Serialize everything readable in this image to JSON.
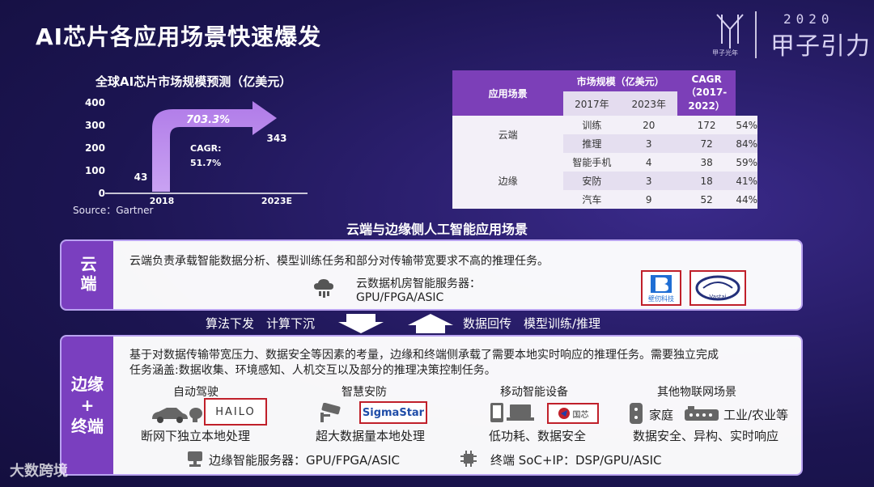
{
  "slide": {
    "title": "AI芯片各应用场景快速爆发",
    "logo_caption": "甲子光年",
    "logo_year": "2020",
    "logo_name": "甲子引力",
    "watermark": "大数跨境"
  },
  "chart_data": {
    "type": "bar",
    "title": "全球AI芯片市场规模预测（亿美元）",
    "categories": [
      "2018",
      "2023E"
    ],
    "values": [
      43,
      343
    ],
    "ylim": [
      0,
      400
    ],
    "yticks": [
      "400",
      "300",
      "200",
      "100",
      "0"
    ],
    "value_labels": [
      "43",
      "343"
    ],
    "growth_label": "703.3%",
    "cagr_label": "CAGR:",
    "cagr_value": "51.7%",
    "source": "Source：Gartner"
  },
  "table": {
    "header_scene": "应用场景",
    "header_market": "市场规模（亿美元）",
    "header_cagr": "CAGR（2017-2022）",
    "header_2017": "2017年",
    "header_2023": "2023年",
    "groups": [
      {
        "name": "云端",
        "rows": [
          {
            "item": "训练",
            "v2017": "20",
            "v2023": "172",
            "cagr": "54%"
          },
          {
            "item": "推理",
            "v2017": "3",
            "v2023": "72",
            "cagr": "84%"
          }
        ]
      },
      {
        "name": "边缘",
        "rows": [
          {
            "item": "智能手机",
            "v2017": "4",
            "v2023": "38",
            "cagr": "59%"
          },
          {
            "item": "安防",
            "v2017": "3",
            "v2023": "18",
            "cagr": "41%"
          },
          {
            "item": "汽车",
            "v2017": "9",
            "v2023": "52",
            "cagr": "44%"
          }
        ]
      }
    ]
  },
  "section_title": "云端与边缘侧人工智能应用场景",
  "cloud": {
    "side_label": "云端",
    "desc": "云端负责承载智能数据分析、模型训练任务和部分对传输带宽要求不高的推理任务。",
    "server_line1": "云数据机房智能服务器：",
    "server_line2": "GPU/FPGA/ASIC",
    "logo1": "壁仞科技",
    "logo2": "Vastai"
  },
  "flow": {
    "down_label": "算法下发　计算下沉",
    "up_label": "数据回传　模型训练/推理"
  },
  "edge": {
    "side_label_1": "边缘",
    "side_label_2": "+",
    "side_label_3": "终端",
    "desc_line1": "基于对数据传输带宽压力、数据安全等因素的考量，边缘和终端侧承载了需要本地实时响应的推理任务。需要独立完成",
    "desc_line2": "任务涵盖:数据收集、环境感知、人机交互以及部分的推理决策控制任务。",
    "scenarios": [
      {
        "title": "自动驾驶",
        "caption": "断网下独立本地处理",
        "logo": "HAILO"
      },
      {
        "title": "智慧安防",
        "caption": "超大数据量本地处理",
        "logo": "SigmaStar"
      },
      {
        "title": "移动智能设备",
        "caption": "低功耗、数据安全",
        "logo": "国芯"
      },
      {
        "title": "其他物联网场景",
        "caption": "数据安全、异构、实时响应",
        "home": "家庭",
        "industry": "工业/农业等"
      }
    ],
    "server": "边缘智能服务器：GPU/FPGA/ASIC",
    "terminal": "终端 SoC+IP：DSP/GPU/ASIC"
  }
}
